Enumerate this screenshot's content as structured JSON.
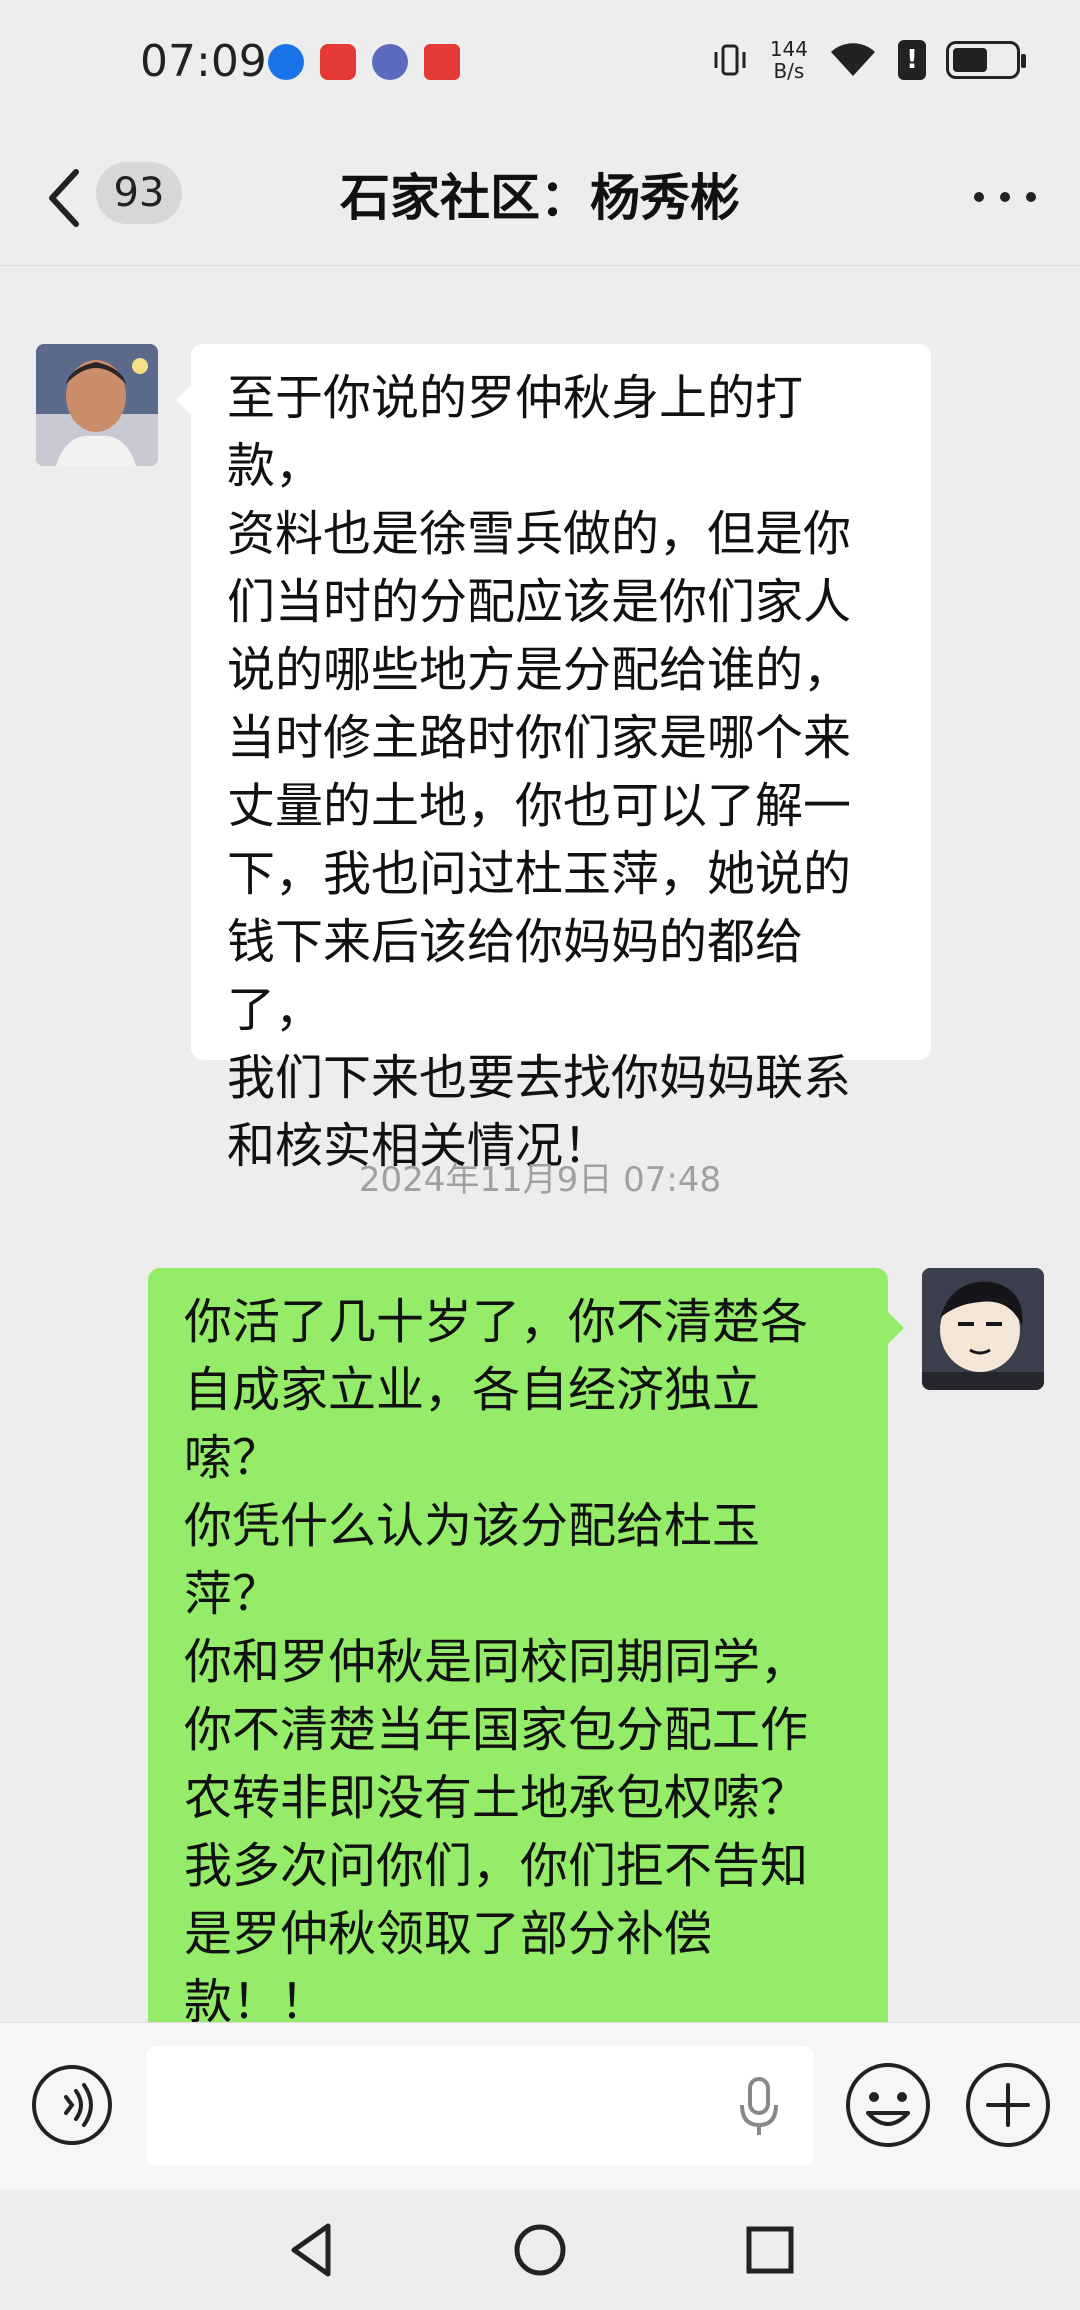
{
  "status_bar": {
    "time": "07:09",
    "net_speed_value": "144",
    "net_speed_unit": "B/s",
    "icons": [
      "app-notification-icon",
      "app-notification-icon",
      "music-icon",
      "video-app-icon",
      "vibrate-icon",
      "wifi-icon",
      "alert-icon",
      "battery-icon"
    ]
  },
  "header": {
    "unread_count": "93",
    "title": "石家社区：杨秀彬",
    "icons": [
      "back-icon",
      "more-icon"
    ]
  },
  "messages": [
    {
      "direction": "incoming",
      "text": "至于你说的罗仲秋身上的打款，\n资料也是徐雪兵做的，但是你\n们当时的分配应该是你们家人\n说的哪些地方是分配给谁的，\n当时修主路时你们家是哪个来\n丈量的土地，你也可以了解一\n下，我也问过杜玉萍，她说的\n钱下来后该给你妈妈的都给了，\n我们下来也要去找你妈妈联系\n和核实相关情况！"
    },
    {
      "type": "timestamp",
      "text": "2024年11月9日 07:48"
    },
    {
      "direction": "outgoing",
      "text": "你活了几十岁了，你不清楚各\n自成家立业，各自经济独立\n嗦？\n你凭什么认为该分配给杜玉\n萍？\n你和罗仲秋是同校同期同学，\n你不清楚当年国家包分配工作\n农转非即没有土地承包权嗦？\n我多次问你们，你们拒不告知\n是罗仲秋领取了部分补偿\n款！！"
    }
  ],
  "input_bar": {
    "placeholder": "",
    "icons": [
      "voice-icon",
      "mic-icon",
      "emoji-icon",
      "plus-icon"
    ]
  },
  "nav_bar": {
    "icons": [
      "nav-back-icon",
      "nav-home-icon",
      "nav-recent-icon"
    ]
  },
  "colors": {
    "background": "#ededed",
    "incoming_bubble": "#ffffff",
    "outgoing_bubble": "#95ec69",
    "timestamp": "#a0a0a0"
  }
}
